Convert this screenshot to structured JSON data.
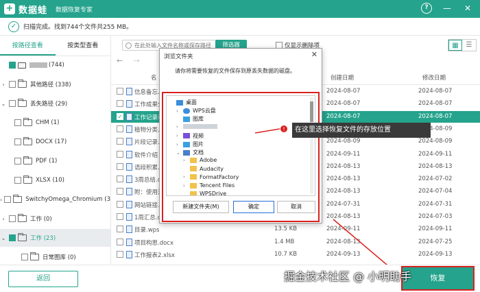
{
  "app": {
    "logo_char": "+",
    "name": "数据蛙",
    "tagline": "数据恢复专家",
    "help": "?",
    "minimize": "—",
    "close": "✕"
  },
  "status": {
    "check": "✓",
    "text": "扫描完成。找到744个文件共255 MB。"
  },
  "sidebar": {
    "tabs": [
      "按路径查看",
      "按类型查看"
    ],
    "tree": [
      {
        "chevron": "",
        "label": "(744)",
        "blurred": true
      },
      {
        "chevron": "›",
        "label": "其他路径 (338)"
      },
      {
        "chevron": "⌄",
        "label": "丢失路径 (29)"
      },
      {
        "chevron": "",
        "label": "CHM (1)"
      },
      {
        "chevron": "",
        "label": "DOCX (17)"
      },
      {
        "chevron": "",
        "label": "PDF (1)"
      },
      {
        "chevron": "",
        "label": "XLSX (10)"
      },
      {
        "chevron": "›",
        "label": "SwitchyOmega_Chromium (3"
      },
      {
        "chevron": "›",
        "label": "工作 (0)"
      },
      {
        "chevron": "⌄",
        "label": "工作 (23)"
      },
      {
        "chevron": "",
        "label": "日常图库 (0)"
      }
    ]
  },
  "toolbar": {
    "search_placeholder": "在此处输入文件名称或保存路径",
    "filter_label": "筛选器",
    "only_deleted_label": "仅显示删除项",
    "view_grid": "▦",
    "view_list": "☰"
  },
  "nav": {
    "back": "←",
    "forward": "→"
  },
  "file_list": {
    "headers": {
      "name": "名",
      "created": "创建日期",
      "modified": "修改日期"
    },
    "rows": [
      {
        "name": "信息备忘.t",
        "size": "",
        "created": "2024-08-07",
        "modified": "2024-08-07"
      },
      {
        "name": "工作成果分",
        "size": "",
        "created": "2024-08-07",
        "modified": "2024-08-07"
      },
      {
        "name": "工作记录表",
        "size": "",
        "created": "2024-08-07",
        "modified": "2024-08-07"
      },
      {
        "name": "植物分类.d",
        "size": "",
        "created": "2024-08-09",
        "modified": "2024-08-09"
      },
      {
        "name": "片段记录.d",
        "size": "",
        "created": "2024-08-09",
        "modified": "2024-08-09"
      },
      {
        "name": "软件介绍",
        "size": "",
        "created": "2024-09-11",
        "modified": "2024-09-11"
      },
      {
        "name": "语段积累.d",
        "size": "",
        "created": "2024-08-13",
        "modified": "2024-08-13"
      },
      {
        "name": "3周总结.d",
        "size": "",
        "created": "2024-08-13",
        "modified": "2024-07-02"
      },
      {
        "name": "附：使用注",
        "size": "",
        "created": "2024-08-13",
        "modified": "2024-07-04"
      },
      {
        "name": "网站链接.tx",
        "size": "",
        "created": "2024-07-31",
        "modified": "2024-07-31"
      },
      {
        "name": "1周汇总.docx",
        "size": "",
        "created": "2024-08-13",
        "modified": "2024-07-03"
      },
      {
        "name": "目录.wps",
        "size": "13.5 KB",
        "created": "2024-09-11",
        "modified": "2024-09-11"
      },
      {
        "name": "项目构思.docx",
        "size": "1.4 MB",
        "created": "2024-08-13",
        "modified": "2024-07-25"
      },
      {
        "name": "工作报表2.xlsx",
        "size": "10.7 KB",
        "created": "2024-09-13",
        "modified": "2024-09-13"
      }
    ]
  },
  "dialog": {
    "title": "浏览文件夹",
    "close": "✕",
    "description": "请你将需要恢复的文件保存到原丢失数据的磁盘。",
    "tree": [
      {
        "chevron": "",
        "icon": "desk",
        "label": "桌面"
      },
      {
        "chevron": "›",
        "icon": "cloud",
        "label": "WPS云盘"
      },
      {
        "chevron": "",
        "icon": "pic",
        "label": "图库"
      },
      {
        "chevron": "›",
        "icon": "",
        "label": ""
      },
      {
        "chevron": "›",
        "icon": "video",
        "label": "视频"
      },
      {
        "chevron": "›",
        "icon": "pic",
        "label": "图片"
      },
      {
        "chevron": "⌄",
        "icon": "doc",
        "label": "文档"
      },
      {
        "chevron": "›",
        "icon": "fold",
        "label": "Adobe"
      },
      {
        "chevron": "",
        "icon": "fold",
        "label": "Audacity"
      },
      {
        "chevron": "›",
        "icon": "fold",
        "label": "FormatFactory"
      },
      {
        "chevron": "›",
        "icon": "fold",
        "label": "Tencent Files"
      },
      {
        "chevron": "",
        "icon": "fold",
        "label": "WPSDrive"
      }
    ],
    "new_folder": "新建文件夹(M)",
    "ok": "确定",
    "cancel": "取消"
  },
  "callout": {
    "badge": "!",
    "text": "在这里选择恢复文件的存放位置"
  },
  "bottom": {
    "back": "返回",
    "recover": "恢复"
  },
  "watermark": "掘金技术社区 @ 小明助手",
  "colors": {
    "brand": "#25a38c",
    "highlight": "#d9201e"
  }
}
